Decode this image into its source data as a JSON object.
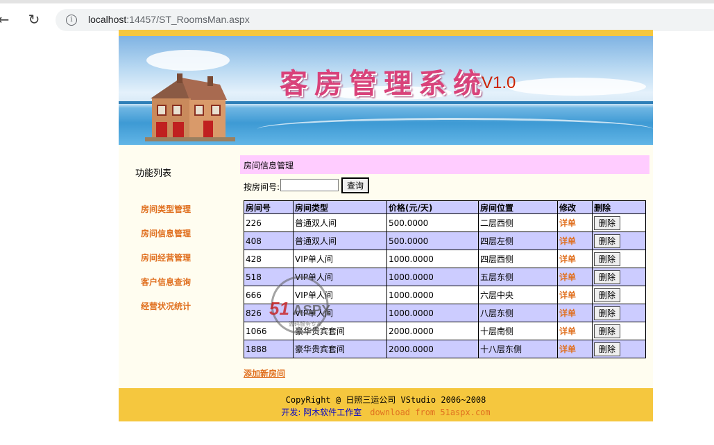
{
  "browser": {
    "url_host": "localhost",
    "url_path": ":14457/ST_RoomsMan.aspx"
  },
  "banner": {
    "title": "客房管理系统",
    "version": "V1.0"
  },
  "sidebar": {
    "heading": "功能列表",
    "items": [
      "房间类型管理",
      "房间信息管理",
      "房间经营管理",
      "客户信息查询",
      "经营状况统计"
    ]
  },
  "section": {
    "title": "房间信息管理"
  },
  "search": {
    "label": "按房间号:",
    "value": "",
    "button": "查询"
  },
  "table": {
    "headers": [
      "房间号",
      "房间类型",
      "价格(元/天)",
      "房间位置",
      "修改",
      "删除"
    ],
    "rows": [
      [
        "226",
        "普通双人间",
        "500.0000",
        "二层西侧",
        "详单",
        "删除"
      ],
      [
        "408",
        "普通双人间",
        "500.0000",
        "四层左侧",
        "详单",
        "删除"
      ],
      [
        "428",
        "VIP单人间",
        "1000.0000",
        "四层西侧",
        "详单",
        "删除"
      ],
      [
        "518",
        "VIP单人间",
        "1000.0000",
        "五层东侧",
        "详单",
        "删除"
      ],
      [
        "666",
        "VIP单人间",
        "1000.0000",
        "六层中央",
        "详单",
        "删除"
      ],
      [
        "826",
        "VIP单人间",
        "1000.0000",
        "八层东侧",
        "详单",
        "删除"
      ],
      [
        "1066",
        "豪华贵宾套间",
        "2000.0000",
        "十层南侧",
        "详单",
        "删除"
      ],
      [
        "1888",
        "豪华贵宾套间",
        "2000.0000",
        "十八层东侧",
        "详单",
        "删除"
      ]
    ]
  },
  "add_room": "添加新房间",
  "footer": {
    "copyright": "CopyRight @ 日照三运公司 VStudio 2006~2008",
    "developer": "开发: 阿木软件工作室",
    "download": "download from 51aspx.com"
  },
  "watermark": {
    "logo": "51ASPX",
    "tagline": "源码服务专家"
  },
  "colors": {
    "accent_orange": "#e07020",
    "gold": "#f5c73e",
    "table_header": "#ccccff",
    "section_bar": "#ffccff"
  }
}
